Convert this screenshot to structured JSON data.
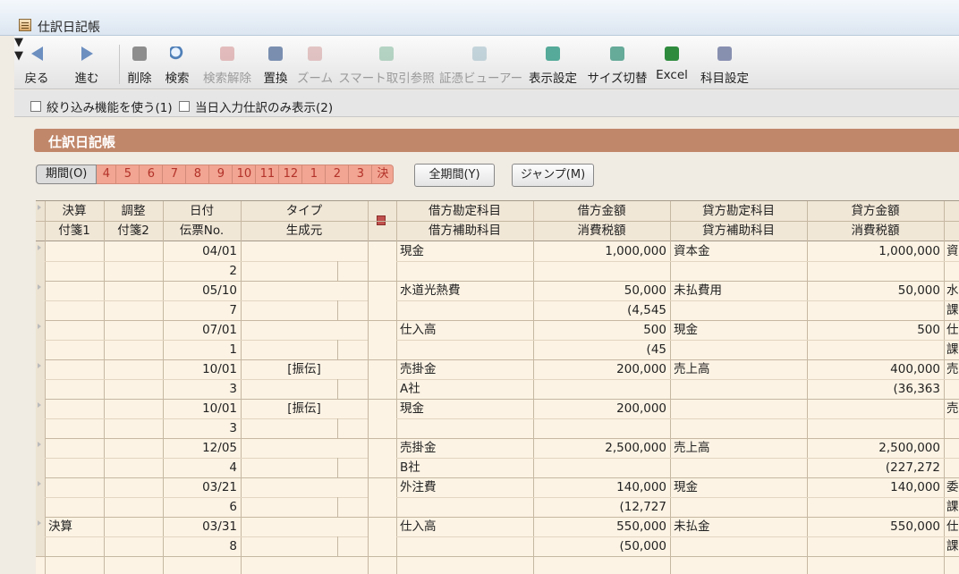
{
  "window": {
    "title": "仕訳日記帳"
  },
  "toolbar": [
    {
      "label": "戻る",
      "icon": "back-arrow-icon",
      "enabled": true
    },
    {
      "label": "進む",
      "icon": "forward-arrow-icon",
      "enabled": true
    },
    {
      "label": "削除",
      "icon": "trash-icon",
      "enabled": true
    },
    {
      "label": "検索",
      "icon": "magnifier-icon",
      "enabled": true
    },
    {
      "label": "検索解除",
      "icon": "clear-search-icon",
      "enabled": false
    },
    {
      "label": "置換",
      "icon": "replace-icon",
      "enabled": true
    },
    {
      "label": "ズーム",
      "icon": "zoom-icon",
      "enabled": false
    },
    {
      "label": "スマート取引参照",
      "icon": "smart-transaction-icon",
      "enabled": false
    },
    {
      "label": "証憑ビューアー",
      "icon": "voucher-viewer-icon",
      "enabled": false
    },
    {
      "label": "表示設定",
      "icon": "display-settings-icon",
      "enabled": true
    },
    {
      "label": "サイズ切替",
      "icon": "size-toggle-icon",
      "enabled": true
    },
    {
      "label": "Excel",
      "icon": "excel-icon",
      "enabled": true
    },
    {
      "label": "科目設定",
      "icon": "account-settings-icon",
      "enabled": true
    }
  ],
  "filters": {
    "narrow": "絞り込み機能を使う(1)",
    "today_only": "当日入力仕訳のみ表示(2)"
  },
  "section_title": "仕訳日記帳",
  "period": {
    "label": "期間(O)",
    "months": [
      "4",
      "5",
      "6",
      "7",
      "8",
      "9",
      "10",
      "11",
      "12",
      "1",
      "2",
      "3",
      "決"
    ],
    "all_button": "全期間(Y)",
    "jump_button": "ジャンプ(M)"
  },
  "table": {
    "headers_top": [
      "決算",
      "調整",
      "日付",
      "タイプ",
      "",
      "借方勘定科目",
      "借方金額",
      "貸方勘定科目",
      "貸方金額"
    ],
    "headers_bottom": [
      "付箋1",
      "付箋2",
      "伝票No.",
      "生成元",
      "",
      "借方補助科目",
      "消費税額",
      "貸方補助科目",
      "消費税額"
    ],
    "rows": [
      {
        "kessan": "",
        "date": "04/01",
        "type": "",
        "no": "2",
        "dr_acct": "現金",
        "dr_sub": "",
        "dr_amt": "1,000,000",
        "dr_tax": "",
        "cr_acct": "資本金",
        "cr_sub": "",
        "cr_amt": "1,000,000",
        "cr_tax": "",
        "extra1": "資",
        "extra2": ""
      },
      {
        "kessan": "",
        "date": "05/10",
        "type": "",
        "no": "7",
        "dr_acct": "水道光熱費",
        "dr_sub": "",
        "dr_amt": "50,000",
        "dr_tax": "(4,545",
        "cr_acct": "未払費用",
        "cr_sub": "",
        "cr_amt": "50,000",
        "cr_tax": "",
        "extra1": "水",
        "extra2": "課"
      },
      {
        "kessan": "",
        "date": "07/01",
        "type": "",
        "no": "1",
        "dr_acct": "仕入高",
        "dr_sub": "",
        "dr_amt": "500",
        "dr_tax": "(45",
        "cr_acct": "現金",
        "cr_sub": "",
        "cr_amt": "500",
        "cr_tax": "",
        "extra1": "仕",
        "extra2": "課"
      },
      {
        "kessan": "",
        "date": "10/01",
        "type": "[振伝]",
        "no": "3",
        "dr_acct": "売掛金",
        "dr_sub": "A社",
        "dr_amt": "200,000",
        "dr_tax": "",
        "cr_acct": "売上高",
        "cr_sub": "",
        "cr_amt": "400,000",
        "cr_tax": "(36,363",
        "extra1": "売",
        "extra2": ""
      },
      {
        "kessan": "",
        "date": "10/01",
        "type": "[振伝]",
        "no": "3",
        "dr_acct": "現金",
        "dr_sub": "",
        "dr_amt": "200,000",
        "dr_tax": "",
        "cr_acct": "",
        "cr_sub": "",
        "cr_amt": "",
        "cr_tax": "",
        "extra1": "売",
        "extra2": ""
      },
      {
        "kessan": "",
        "date": "12/05",
        "type": "",
        "no": "4",
        "dr_acct": "売掛金",
        "dr_sub": "B社",
        "dr_amt": "2,500,000",
        "dr_tax": "",
        "cr_acct": "売上高",
        "cr_sub": "",
        "cr_amt": "2,500,000",
        "cr_tax": "(227,272",
        "extra1": "",
        "extra2": ""
      },
      {
        "kessan": "",
        "date": "03/21",
        "type": "",
        "no": "6",
        "dr_acct": "外注費",
        "dr_sub": "",
        "dr_amt": "140,000",
        "dr_tax": "(12,727",
        "cr_acct": "現金",
        "cr_sub": "",
        "cr_amt": "140,000",
        "cr_tax": "",
        "extra1": "委",
        "extra2": "課"
      },
      {
        "kessan": "決算",
        "date": "03/31",
        "type": "",
        "no": "8",
        "dr_acct": "仕入高",
        "dr_sub": "",
        "dr_amt": "550,000",
        "dr_tax": "(50,000",
        "cr_acct": "未払金",
        "cr_sub": "",
        "cr_amt": "550,000",
        "cr_tax": "",
        "extra1": "仕",
        "extra2": "課"
      }
    ]
  },
  "colors": {
    "accent_band": "#c1876a",
    "month_button": "#f1a592",
    "grid_bg": "#fcf3e4"
  }
}
